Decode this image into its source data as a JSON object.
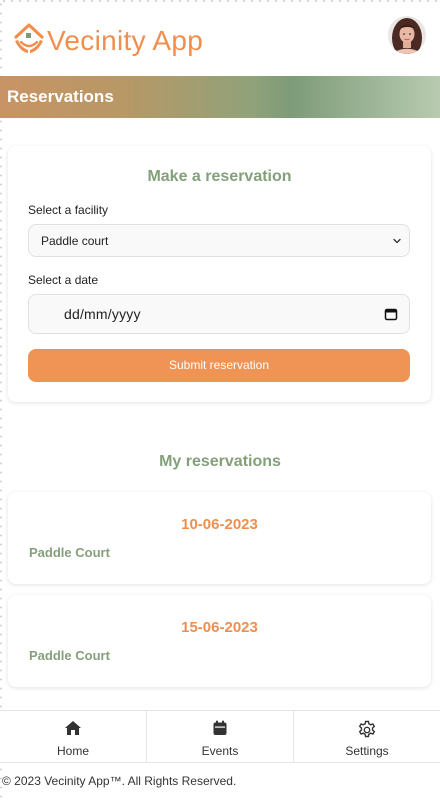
{
  "app": {
    "name": "Vecinity App",
    "brand_color": "#ef8f4f",
    "accent_green": "#84a07a",
    "logo_icon": "house-hands-icon",
    "avatar_icon": "user-avatar"
  },
  "page": {
    "title": "Reservations"
  },
  "form": {
    "title": "Make a reservation",
    "facility_label": "Select a facility",
    "facility_value": "Paddle court",
    "date_label": "Select a date",
    "date_value": "dd/mm/yyyy",
    "submit_label": "Submit reservation"
  },
  "reservations": {
    "title": "My reservations",
    "items": [
      {
        "date": "10-06-2023",
        "facility": "Paddle Court"
      },
      {
        "date": "15-06-2023",
        "facility": "Paddle Court"
      }
    ]
  },
  "nav": {
    "items": [
      {
        "label": "Home",
        "icon": "home-icon"
      },
      {
        "label": "Events",
        "icon": "calendar-icon"
      },
      {
        "label": "Settings",
        "icon": "gear-icon"
      }
    ]
  },
  "footer": {
    "text": "© 2023 Vecinity App™. All Rights Reserved."
  }
}
